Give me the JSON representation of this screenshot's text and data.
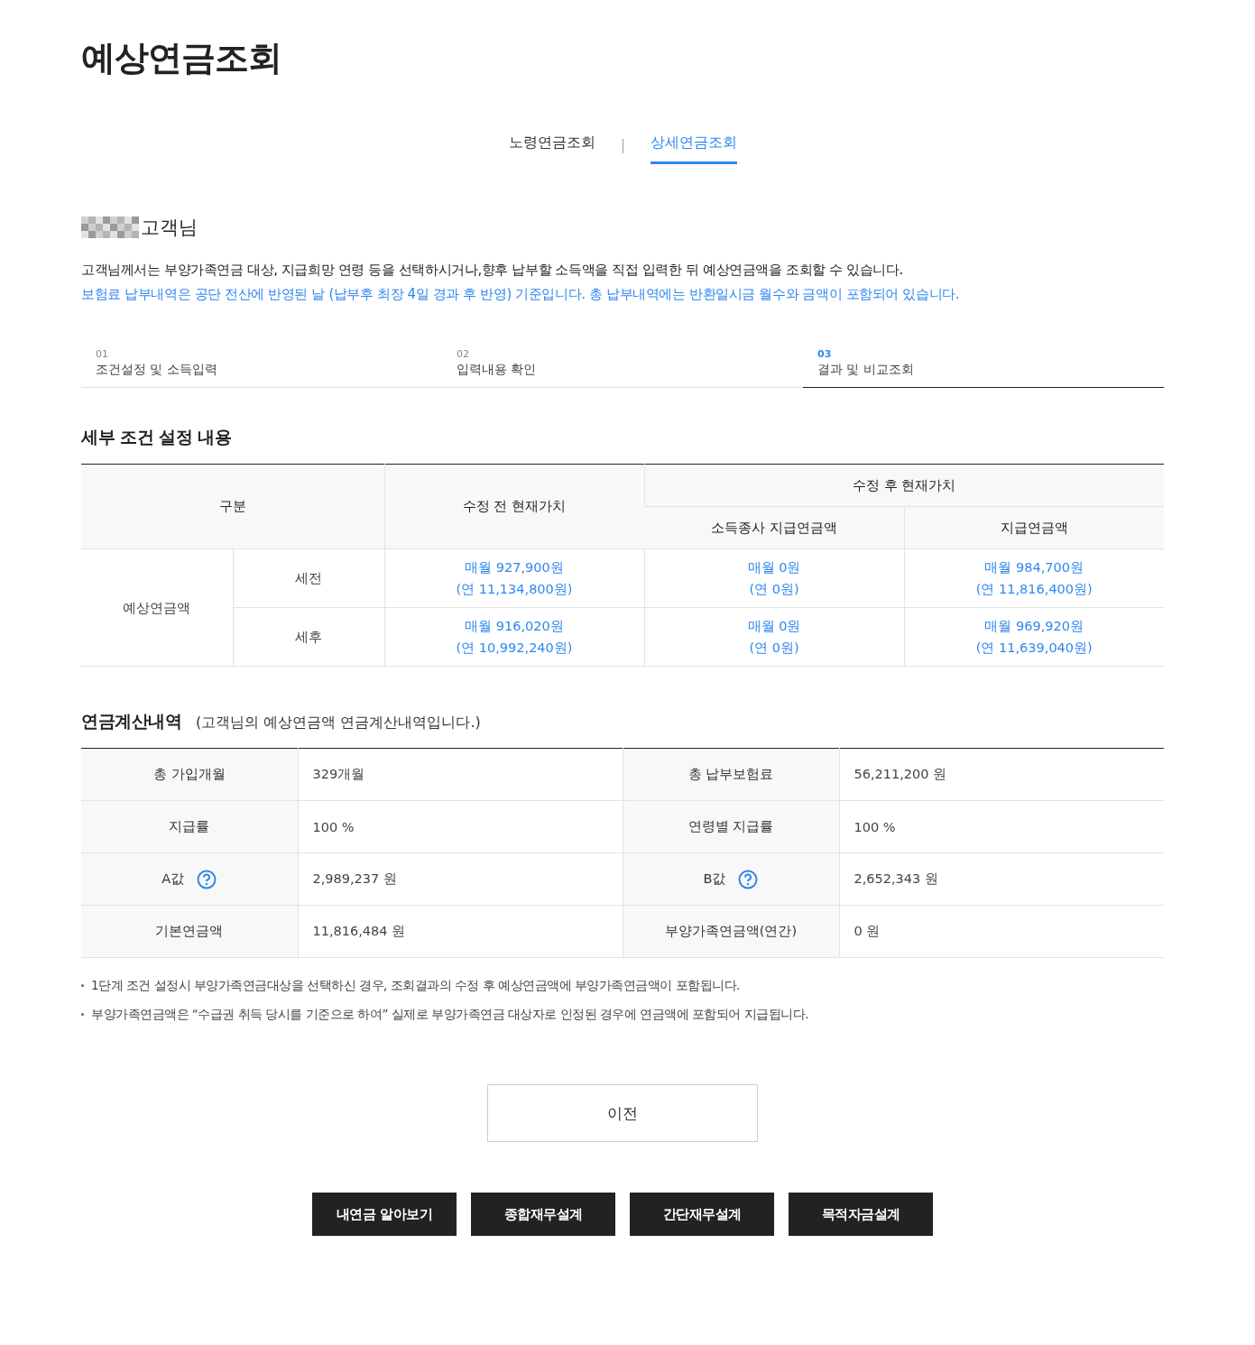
{
  "title": "예상연금조회",
  "tabs": [
    {
      "label": "노령연금조회",
      "selected": false
    },
    {
      "label": "상세연금조회",
      "selected": true
    }
  ],
  "customer": {
    "suffix": "고객님"
  },
  "description": "고객님께서는 부양가족연금 대상, 지급희망 연령 등을 선택하시거나,향후 납부할 소득액을 직접 입력한 뒤 예상연금액을 조회할 수 있습니다.",
  "notice": "보험료 납부내역은 공단 전산에 반영된 날 (납부후 최장 4일 경과 후 반영) 기준입니다. 총 납부내역에는 반환일시금 월수와 금액이 포함되어 있습니다.",
  "steps": [
    {
      "number": "01",
      "label": "조건설정 및 소득입력",
      "selected": false
    },
    {
      "number": "02",
      "label": "입력내용 확인",
      "selected": false
    },
    {
      "number": "03",
      "label": "결과 및 비교조회",
      "selected": true
    }
  ],
  "conditions": {
    "title": "세부 조건 설정 내용",
    "headers": {
      "category": "구분",
      "before": "수정 전 현재가치",
      "after": "수정 후 현재가치",
      "after_sub": [
        "소득종사 지급연금액",
        "지급연금액"
      ]
    },
    "group": "예상연금액",
    "rows": [
      {
        "label": "세전",
        "values": [
          {
            "monthly": "매월 927,900원",
            "annual": "(연 11,134,800원)"
          },
          {
            "monthly": "매월 0원",
            "annual": "(연 0원)"
          },
          {
            "monthly": "매월 984,700원",
            "annual": "(연 11,816,400원)"
          }
        ]
      },
      {
        "label": "세후",
        "values": [
          {
            "monthly": "매월 916,020원",
            "annual": "(연 10,992,240원)"
          },
          {
            "monthly": "매월 0원",
            "annual": "(연 0원)"
          },
          {
            "monthly": "매월 969,920원",
            "annual": "(연 11,639,040원)"
          }
        ]
      }
    ]
  },
  "calculation": {
    "title": "연금계산내역",
    "subtitle": "(고객님의 예상연금액 연금계산내역입니다.)",
    "rows": [
      [
        {
          "label": "총 가입개월",
          "value": "329개월",
          "help": false
        },
        {
          "label": "총 납부보험료",
          "value": "56,211,200 원",
          "help": false
        }
      ],
      [
        {
          "label": "지급률",
          "value": "100 %",
          "help": false
        },
        {
          "label": "연령별 지급률",
          "value": "100 %",
          "help": false
        }
      ],
      [
        {
          "label": "A값",
          "value": "2,989,237 원",
          "help": true
        },
        {
          "label": "B값",
          "value": "2,652,343 원",
          "help": true
        }
      ],
      [
        {
          "label": "기본연금액",
          "value": "11,816,484 원",
          "help": false
        },
        {
          "label": "부양가족연금액(연간)",
          "value": "0 원",
          "help": false
        }
      ]
    ]
  },
  "notes": [
    "1단계 조건 설정시 부양가족연금대상을 선택하신 경우, 조회결과의 수정 후 예상연금액에 부양가족연금액이 포함됩니다.",
    "부양가족연금액은 “수급권 취득 당시를 기준으로 하여” 실제로 부양가족연금 대상자로 인정된 경우에 연금액에 포함되어 지급됩니다."
  ],
  "prev_button": "이전",
  "buttons": [
    "내연금 알아보기",
    "종합재무설계",
    "간단재무설계",
    "목적자금설계"
  ]
}
